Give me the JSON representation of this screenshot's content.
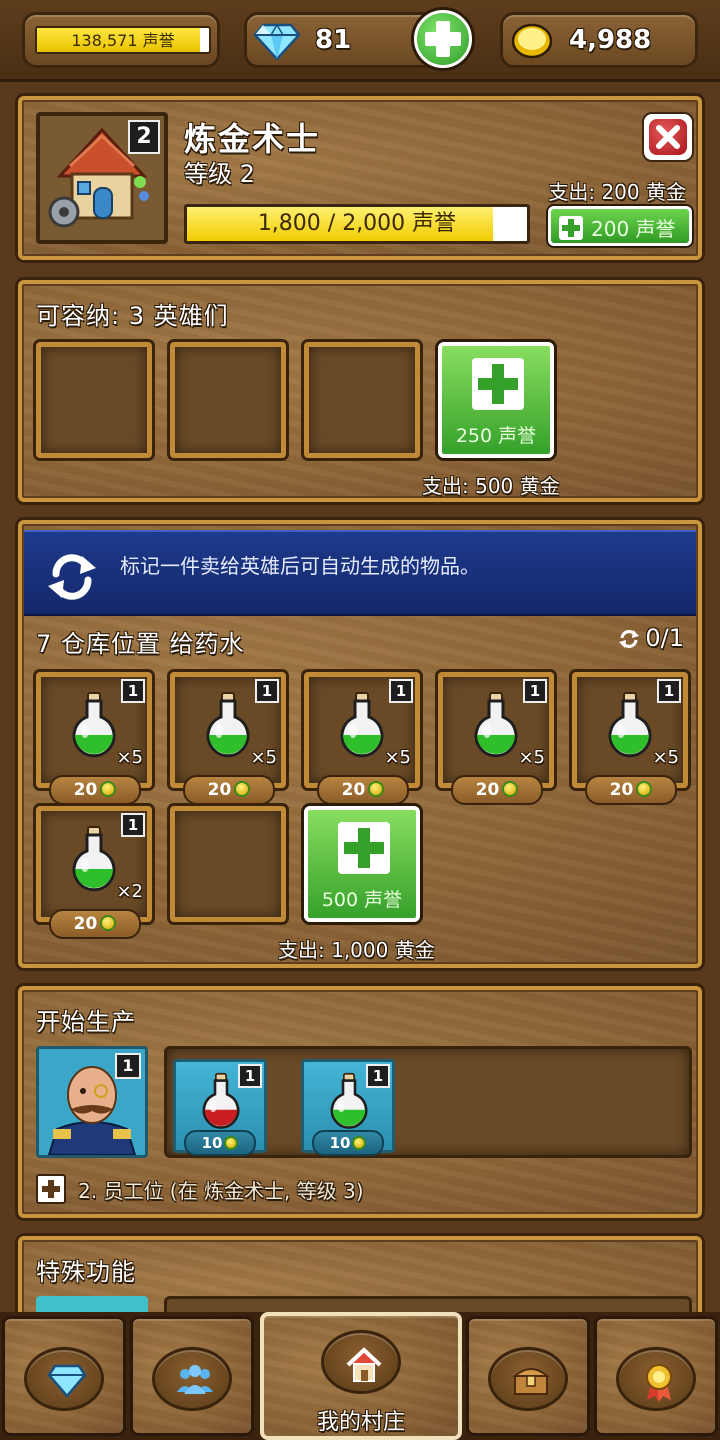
{
  "topbar": {
    "reputation_text": "138,571 声誉",
    "reputation_fill": 0.95,
    "gems": "81",
    "gold": "4,988"
  },
  "building": {
    "name": "炼金术士",
    "level_label": "等级 2",
    "level_badge": "2",
    "upgrade_cost": "支出: 200 黄金",
    "progress_text": "1,800 / 2,000 声誉",
    "progress_fraction": 0.9,
    "upgrade_button_label": "200 声誉"
  },
  "heroes": {
    "title": "可容纳: 3 英雄们",
    "add_slot_label": "250 声誉",
    "add_slot_cost": "支出: 500 黄金"
  },
  "storage": {
    "info_text": "标记一件卖给英雄后可自动生成的物品。",
    "title": "7 仓库位置 给药水",
    "counter": "0/1",
    "items": [
      {
        "level": "1",
        "qty": "×5",
        "price": "20"
      },
      {
        "level": "1",
        "qty": "×5",
        "price": "20"
      },
      {
        "level": "1",
        "qty": "×5",
        "price": "20"
      },
      {
        "level": "1",
        "qty": "×5",
        "price": "20"
      },
      {
        "level": "1",
        "qty": "×5",
        "price": "20"
      },
      {
        "level": "1",
        "qty": "×2",
        "price": "20"
      }
    ],
    "add_slot_label": "500 声誉",
    "add_slot_cost": "支出: 1,000 黄金"
  },
  "production": {
    "title": "开始生产",
    "worker_level": "1",
    "queue": [
      {
        "level": "1",
        "price": "10",
        "color": "#c81e22"
      },
      {
        "level": "1",
        "price": "10",
        "color": "#2fbf2a"
      }
    ],
    "add_worker_label": "2. 员工位 (在 炼金术士, 等级 3)"
  },
  "special": {
    "title": "特殊功能"
  },
  "nav": {
    "village_label": "我的村庄",
    "icons": [
      "gem-icon",
      "heroes-icon",
      "house-icon",
      "chest-icon",
      "medal-icon"
    ]
  },
  "colors": {
    "potion_green": "#2fbf2a",
    "potion_red": "#c81e22",
    "accent_green": "#35a12b",
    "panel_border": "#c9953e",
    "banner_blue": "#1d3a8c"
  }
}
